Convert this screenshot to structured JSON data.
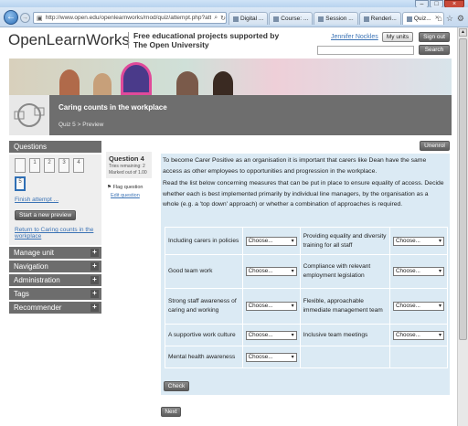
{
  "browser": {
    "url": "http://www.open.edu/openlearnworks/mod/quiz/attempt.php?attem",
    "tabs": [
      {
        "label": "Digital ..."
      },
      {
        "label": "Course: ..."
      },
      {
        "label": "Session ..."
      },
      {
        "label": "Renderi..."
      },
      {
        "label": "Quiz..."
      }
    ],
    "winbtns": [
      "–",
      "□",
      "×"
    ]
  },
  "header": {
    "logo_a": "OpenLearn",
    "logo_b": "Works",
    "tagline_1": "Free educational projects supported by",
    "tagline_2": "The Open University",
    "user": "Jennifer Nockles",
    "my_units": "My units",
    "sign_out": "Sign out",
    "search_label": "Search"
  },
  "course": {
    "title": "Caring counts in the workplace",
    "crumb_quiz": "Quiz 5",
    "crumb_sep": ">",
    "crumb_preview": "Preview"
  },
  "sidebar": {
    "questions_title": "Questions",
    "qboxes": [
      "1",
      "2",
      "3",
      "4",
      "5",
      "6"
    ],
    "finish_link": "Finish attempt ...",
    "new_preview": "Start a new preview",
    "return_link": "Return to Caring counts in the workplace",
    "blocks": [
      {
        "label": "Manage unit"
      },
      {
        "label": "Navigation"
      },
      {
        "label": "Administration"
      },
      {
        "label": "Tags"
      },
      {
        "label": "Recommender"
      }
    ]
  },
  "question": {
    "title": "Question 4",
    "tries": "Tries remaining: 2",
    "marked": "Marked out of 1.00",
    "flag": "Flag question",
    "edit": "Edit question",
    "unenrol": "Unenrol",
    "para1": "To become Carer Positive as an organisation it is important that carers like Dean have the same access as other employees to opportunities and progression in the workplace.",
    "para2": "Read the list below concerning measures that can be put in place to ensure equality of access. Decide whether each is best implemented primarily by individual line managers, by the organisation as a whole (e.g. a 'top down' approach) or whether a combination of approaches is required.",
    "placeholder": "Choose...",
    "items": [
      {
        "left": "Including carers in policies",
        "right": "Providing equality and diversity training for all staff"
      },
      {
        "left": "Good team work",
        "right": "Compliance with relevant employment legislation"
      },
      {
        "left": "Strong staff awareness of caring and working",
        "right": "Flexible, approachable immediate management team"
      },
      {
        "left": "A supportive work culture",
        "right": "Inclusive team meetings"
      },
      {
        "left": "Mental health awareness",
        "right": ""
      }
    ],
    "check": "Check",
    "next": "Next"
  }
}
